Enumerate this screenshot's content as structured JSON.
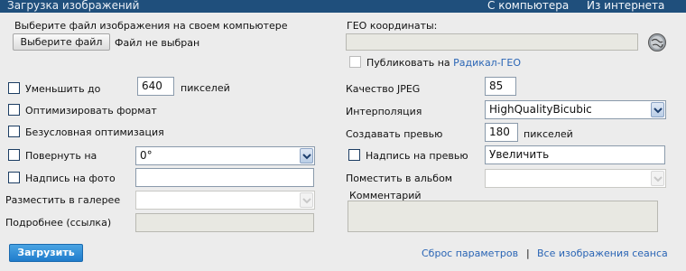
{
  "header": {
    "title": "Загрузка изображений",
    "links": [
      "С компьютера",
      "Из интернета"
    ]
  },
  "file": {
    "prompt": "Выберите файл изображения на своем компьютере",
    "button_label": "Выберите файл",
    "status": "Файл не выбран"
  },
  "geo": {
    "label": "ГЕО координаты:",
    "value": "",
    "publish_prefix": "Публиковать на",
    "publish_link": "Радикал-ГЕО"
  },
  "left_options": {
    "reduce_label": "Уменьшить до",
    "reduce_value": "640",
    "reduce_unit": "пикселей",
    "optimize_format": "Оптимизировать формат",
    "unconditional_optimization": "Безусловная оптимизация",
    "rotate_label": "Повернуть на",
    "rotate_value": "0°",
    "caption_label": "Надпись на фото",
    "caption_value": "",
    "gallery_label": "Разместить в галерее",
    "gallery_value": "",
    "details_label": "Подробнее (ссылка)",
    "details_value": ""
  },
  "right_options": {
    "jpeg_label": "Качество JPEG",
    "jpeg_value": "85",
    "interp_label": "Интерполяция",
    "interp_value": "HighQualityBicubic",
    "preview_label": "Создавать превью",
    "preview_value": "180",
    "preview_unit": "пикселей",
    "preview_caption_label": "Надпись на превью",
    "preview_caption_value": "Увеличить",
    "album_label": "Поместить в альбом",
    "album_value": "",
    "comment_label": "Комментарий",
    "comment_value": ""
  },
  "footer": {
    "upload_label": "Загрузить",
    "reset_link": "Сброс параметров",
    "separator": "|",
    "session_link": "Все изображения сеанса"
  },
  "colors": {
    "header_bg": "#1f4f7c",
    "background": "#ececec",
    "link": "#2a65b5",
    "upload_button": "#2b88d4"
  }
}
